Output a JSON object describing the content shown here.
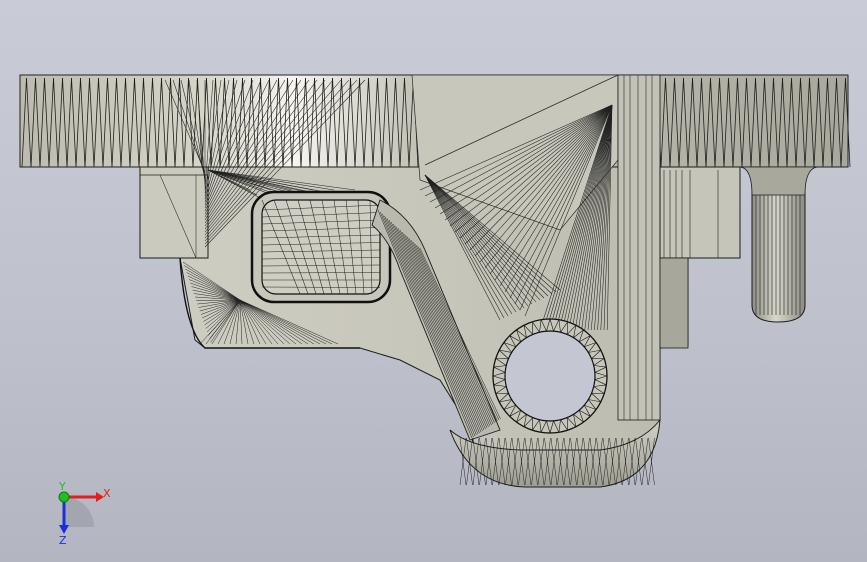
{
  "viewport": {
    "background_color": "#c4c7d1",
    "part_color": "#c9c8bd",
    "part_highlight": "#f4f3ec",
    "mesh_color": "#1a1a1a",
    "model": "wireframe-mesh-bracket"
  },
  "triad": {
    "x_label": "X",
    "y_label": "Y",
    "z_label": "Z",
    "x_color": "#e0201c",
    "y_color": "#1ec21e",
    "z_color": "#1c2fd6"
  }
}
